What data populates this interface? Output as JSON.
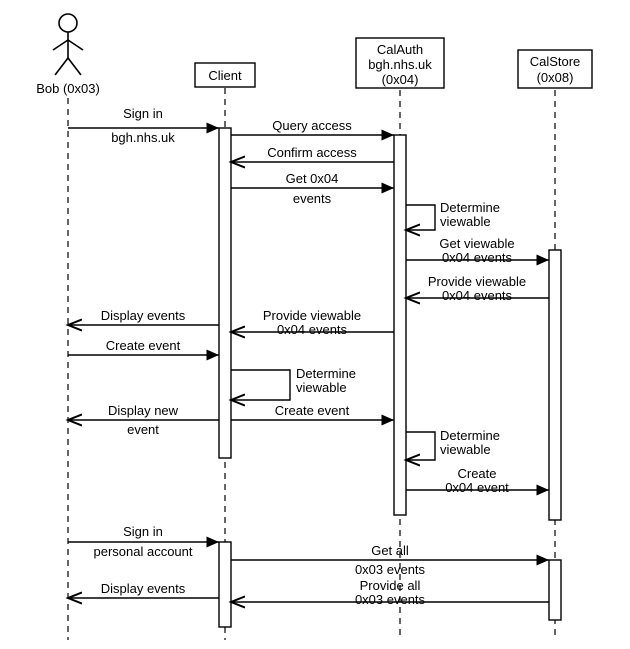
{
  "actor": {
    "label": "Bob (0x03)"
  },
  "participants": {
    "client": {
      "label": "Client"
    },
    "calauth": {
      "line1": "CalAuth",
      "line2": "bgh.nhs.uk",
      "line3": "(0x04)"
    },
    "calstore": {
      "line1": "CalStore",
      "line2": "(0x08)"
    }
  },
  "messages": {
    "m1a": "Sign in",
    "m1b": "bgh.nhs.uk",
    "m2": "Query access",
    "m3": "Confirm access",
    "m4a": "Get 0x04",
    "m4b": "events",
    "m5a": "Determine",
    "m5b": "viewable",
    "m6a": "Get viewable",
    "m6b": "0x04 events",
    "m7a": "Provide viewable",
    "m7b": "0x04 events",
    "m8a": "Provide viewable",
    "m8b": "0x04 events",
    "m9": "Display events",
    "m10": "Create event",
    "m11a": "Determine",
    "m11b": "viewable",
    "m12": "Create event",
    "m13a": "Display new",
    "m13b": "event",
    "m14a": "Determine",
    "m14b": "viewable",
    "m15a": "Create",
    "m15b": "0x04 event",
    "m16a": "Sign in",
    "m16b": "personal account",
    "m17a": "Get all",
    "m17b": "0x03 events",
    "m18a": "Provide all",
    "m18b": "0x03 events",
    "m19": "Display events"
  },
  "chart_data": {
    "type": "table",
    "title": "UML sequence diagram",
    "participants": [
      "Bob (0x03)",
      "Client",
      "CalAuth bgh.nhs.uk (0x04)",
      "CalStore (0x08)"
    ],
    "interactions": [
      {
        "from": "Bob (0x03)",
        "to": "Client",
        "label": "Sign in bgh.nhs.uk"
      },
      {
        "from": "Client",
        "to": "CalAuth bgh.nhs.uk (0x04)",
        "label": "Query access"
      },
      {
        "from": "CalAuth bgh.nhs.uk (0x04)",
        "to": "Client",
        "label": "Confirm access"
      },
      {
        "from": "Client",
        "to": "CalAuth bgh.nhs.uk (0x04)",
        "label": "Get 0x04 events"
      },
      {
        "from": "CalAuth bgh.nhs.uk (0x04)",
        "to": "CalAuth bgh.nhs.uk (0x04)",
        "label": "Determine viewable"
      },
      {
        "from": "CalAuth bgh.nhs.uk (0x04)",
        "to": "CalStore (0x08)",
        "label": "Get viewable 0x04 events"
      },
      {
        "from": "CalStore (0x08)",
        "to": "CalAuth bgh.nhs.uk (0x04)",
        "label": "Provide viewable 0x04 events"
      },
      {
        "from": "CalAuth bgh.nhs.uk (0x04)",
        "to": "Client",
        "label": "Provide viewable 0x04 events"
      },
      {
        "from": "Client",
        "to": "Bob (0x03)",
        "label": "Display events"
      },
      {
        "from": "Bob (0x03)",
        "to": "Client",
        "label": "Create event"
      },
      {
        "from": "Client",
        "to": "Client",
        "label": "Determine viewable"
      },
      {
        "from": "Client",
        "to": "CalAuth bgh.nhs.uk (0x04)",
        "label": "Create event"
      },
      {
        "from": "Client",
        "to": "Bob (0x03)",
        "label": "Display new event"
      },
      {
        "from": "CalAuth bgh.nhs.uk (0x04)",
        "to": "CalAuth bgh.nhs.uk (0x04)",
        "label": "Determine viewable"
      },
      {
        "from": "CalAuth bgh.nhs.uk (0x04)",
        "to": "CalStore (0x08)",
        "label": "Create 0x04 event"
      },
      {
        "from": "Bob (0x03)",
        "to": "Client",
        "label": "Sign in personal account"
      },
      {
        "from": "Client",
        "to": "CalStore (0x08)",
        "label": "Get all 0x03 events"
      },
      {
        "from": "CalStore (0x08)",
        "to": "Client",
        "label": "Provide all 0x03 events"
      },
      {
        "from": "Client",
        "to": "Bob (0x03)",
        "label": "Display events"
      }
    ]
  }
}
